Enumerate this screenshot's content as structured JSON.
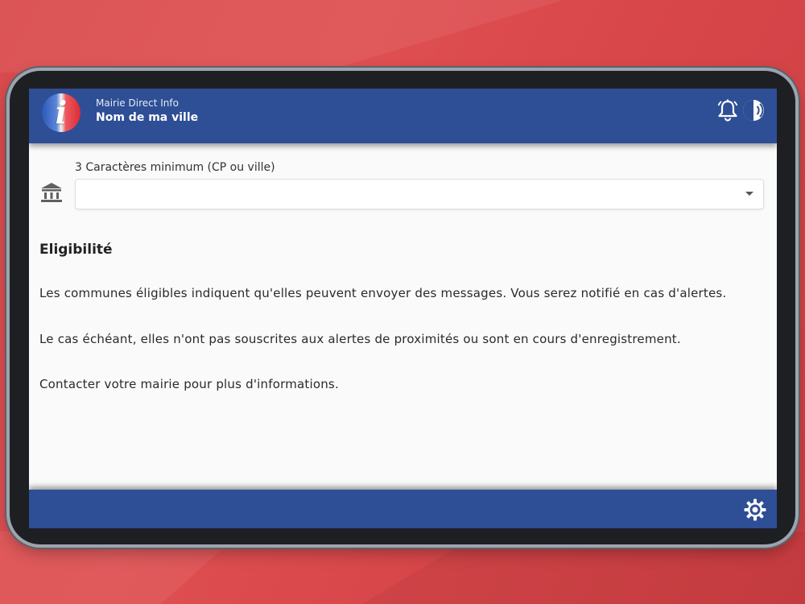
{
  "header": {
    "app_name": "Mairie Direct Info",
    "city_name": "Nom de ma ville",
    "logo_letter": "i",
    "icons": [
      "bell-icon",
      "sound-icon"
    ]
  },
  "city_field": {
    "label": "3 Caractères minimum (CP ou ville)",
    "value": "",
    "icon": "bank-icon"
  },
  "content": {
    "title": "Eligibilité",
    "paragraphs": [
      "Les communes éligibles indiquent qu'elles peuvent envoyer des messages. Vous serez notifié en cas d'alertes.",
      "Le cas échéant, elles n'ont pas souscrites aux alertes de proximités ou sont en cours d'enregistrement.",
      "Contacter votre mairie pour plus d'informations."
    ]
  },
  "footer": {
    "icons": [
      "gear-icon"
    ]
  },
  "colors": {
    "header_bg": "#2e4f95",
    "page_bg": "#d94a4c",
    "screen_bg": "#fafafa"
  }
}
